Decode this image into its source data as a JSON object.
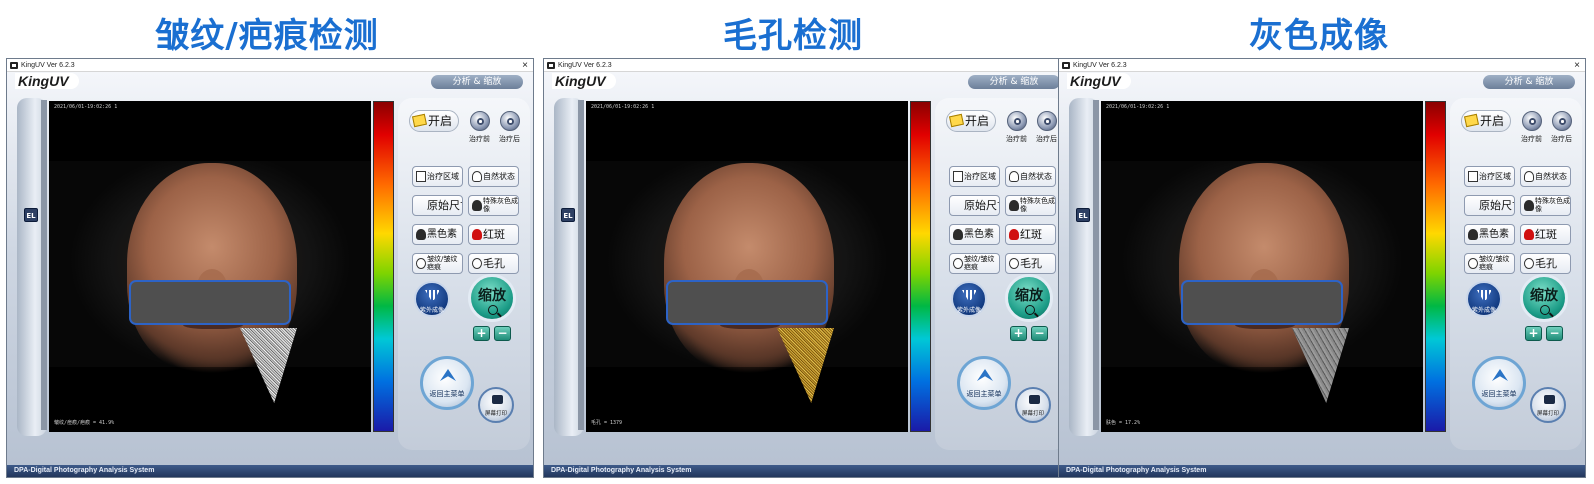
{
  "panels": [
    {
      "heading": "皱纹/疤痕检测",
      "window_title": "KingUV Ver 6.2.3",
      "timestamp": "2021/06/01-19:02:26 1",
      "result": "皱纹/痘痕/疤痕 = 41.9%",
      "overlay": "wrinkle"
    },
    {
      "heading": "毛孔检测",
      "window_title": "KingUV Ver 6.2.3",
      "timestamp": "2021/06/01-19:02:26 1",
      "result": "毛孔 = 1379",
      "overlay": "pore"
    },
    {
      "heading": "灰色成像",
      "window_title": "KingUV Ver 6.2.3",
      "timestamp": "2021/06/01-19:02:26 1",
      "result": "肤色 = 17.2%",
      "overlay": "gray"
    }
  ],
  "common": {
    "logo": "KingUV",
    "close": "×",
    "zoom_header": "分析 & 缩放",
    "el_button": "EL",
    "open": "开启",
    "before_label": "治疗前",
    "after_label": "治疗后",
    "treat_area": "治疗区域",
    "natural_state": "自然状态",
    "original_size": "原始尺寸",
    "special_gray": "特殊灰色成像",
    "melanin": "黑色素",
    "erythema": "红斑",
    "wrinkle_scar": "皱纹/皱纹疤痕",
    "pores": "毛孔",
    "uv_imaging": "紫外成像",
    "zoom": "缩放",
    "plus": "+",
    "minus": "−",
    "main_menu": "返回主菜单",
    "print_screen": "屏幕打印",
    "status": "DPA-Digital Photography Analysis System"
  }
}
